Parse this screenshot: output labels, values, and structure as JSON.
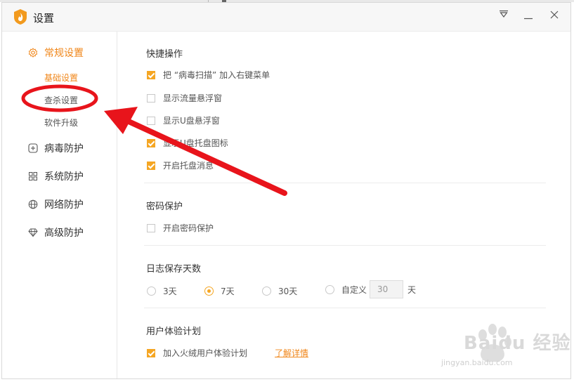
{
  "window": {
    "title": "设置"
  },
  "sidebar": {
    "items": [
      {
        "label": "常规设置",
        "icon": "gear-icon",
        "active": true,
        "subitems": [
          {
            "label": "基础设置",
            "active": true
          },
          {
            "label": "查杀设置"
          },
          {
            "label": "软件升级"
          }
        ]
      },
      {
        "label": "病毒防护",
        "icon": "plus-square-icon"
      },
      {
        "label": "系统防护",
        "icon": "grid-icon"
      },
      {
        "label": "网络防护",
        "icon": "globe-icon"
      },
      {
        "label": "高级防护",
        "icon": "diamond-icon"
      }
    ]
  },
  "main": {
    "quick_ops": {
      "title": "快捷操作",
      "options": [
        {
          "label": "把 “病毒扫描” 加入右键菜单",
          "checked": true
        },
        {
          "label": "显示流量悬浮窗",
          "checked": false
        },
        {
          "label": "显示U盘悬浮窗",
          "checked": false
        },
        {
          "label": "显示U盘托盘图标",
          "checked": true
        },
        {
          "label": "开启托盘消息",
          "checked": true
        }
      ]
    },
    "password": {
      "title": "密码保护",
      "options": [
        {
          "label": "开启密码保护",
          "checked": false
        }
      ]
    },
    "log_days": {
      "title": "日志保存天数",
      "options": [
        {
          "label": "3天"
        },
        {
          "label": "7天",
          "selected": true
        },
        {
          "label": "30天"
        },
        {
          "label": "自定义"
        }
      ],
      "custom_value": "30",
      "custom_unit": "天"
    },
    "ux_plan": {
      "title": "用户体验计划",
      "option": {
        "label": "加入火绒用户体验计划",
        "checked": true
      },
      "link": "了解详情"
    }
  },
  "watermark": {
    "text": "Baidu 经验",
    "url": "jingyan.baidu.com"
  },
  "colors": {
    "accent": "#f08619",
    "checkbox": "#f5a623",
    "annotation": "#e8141b"
  }
}
